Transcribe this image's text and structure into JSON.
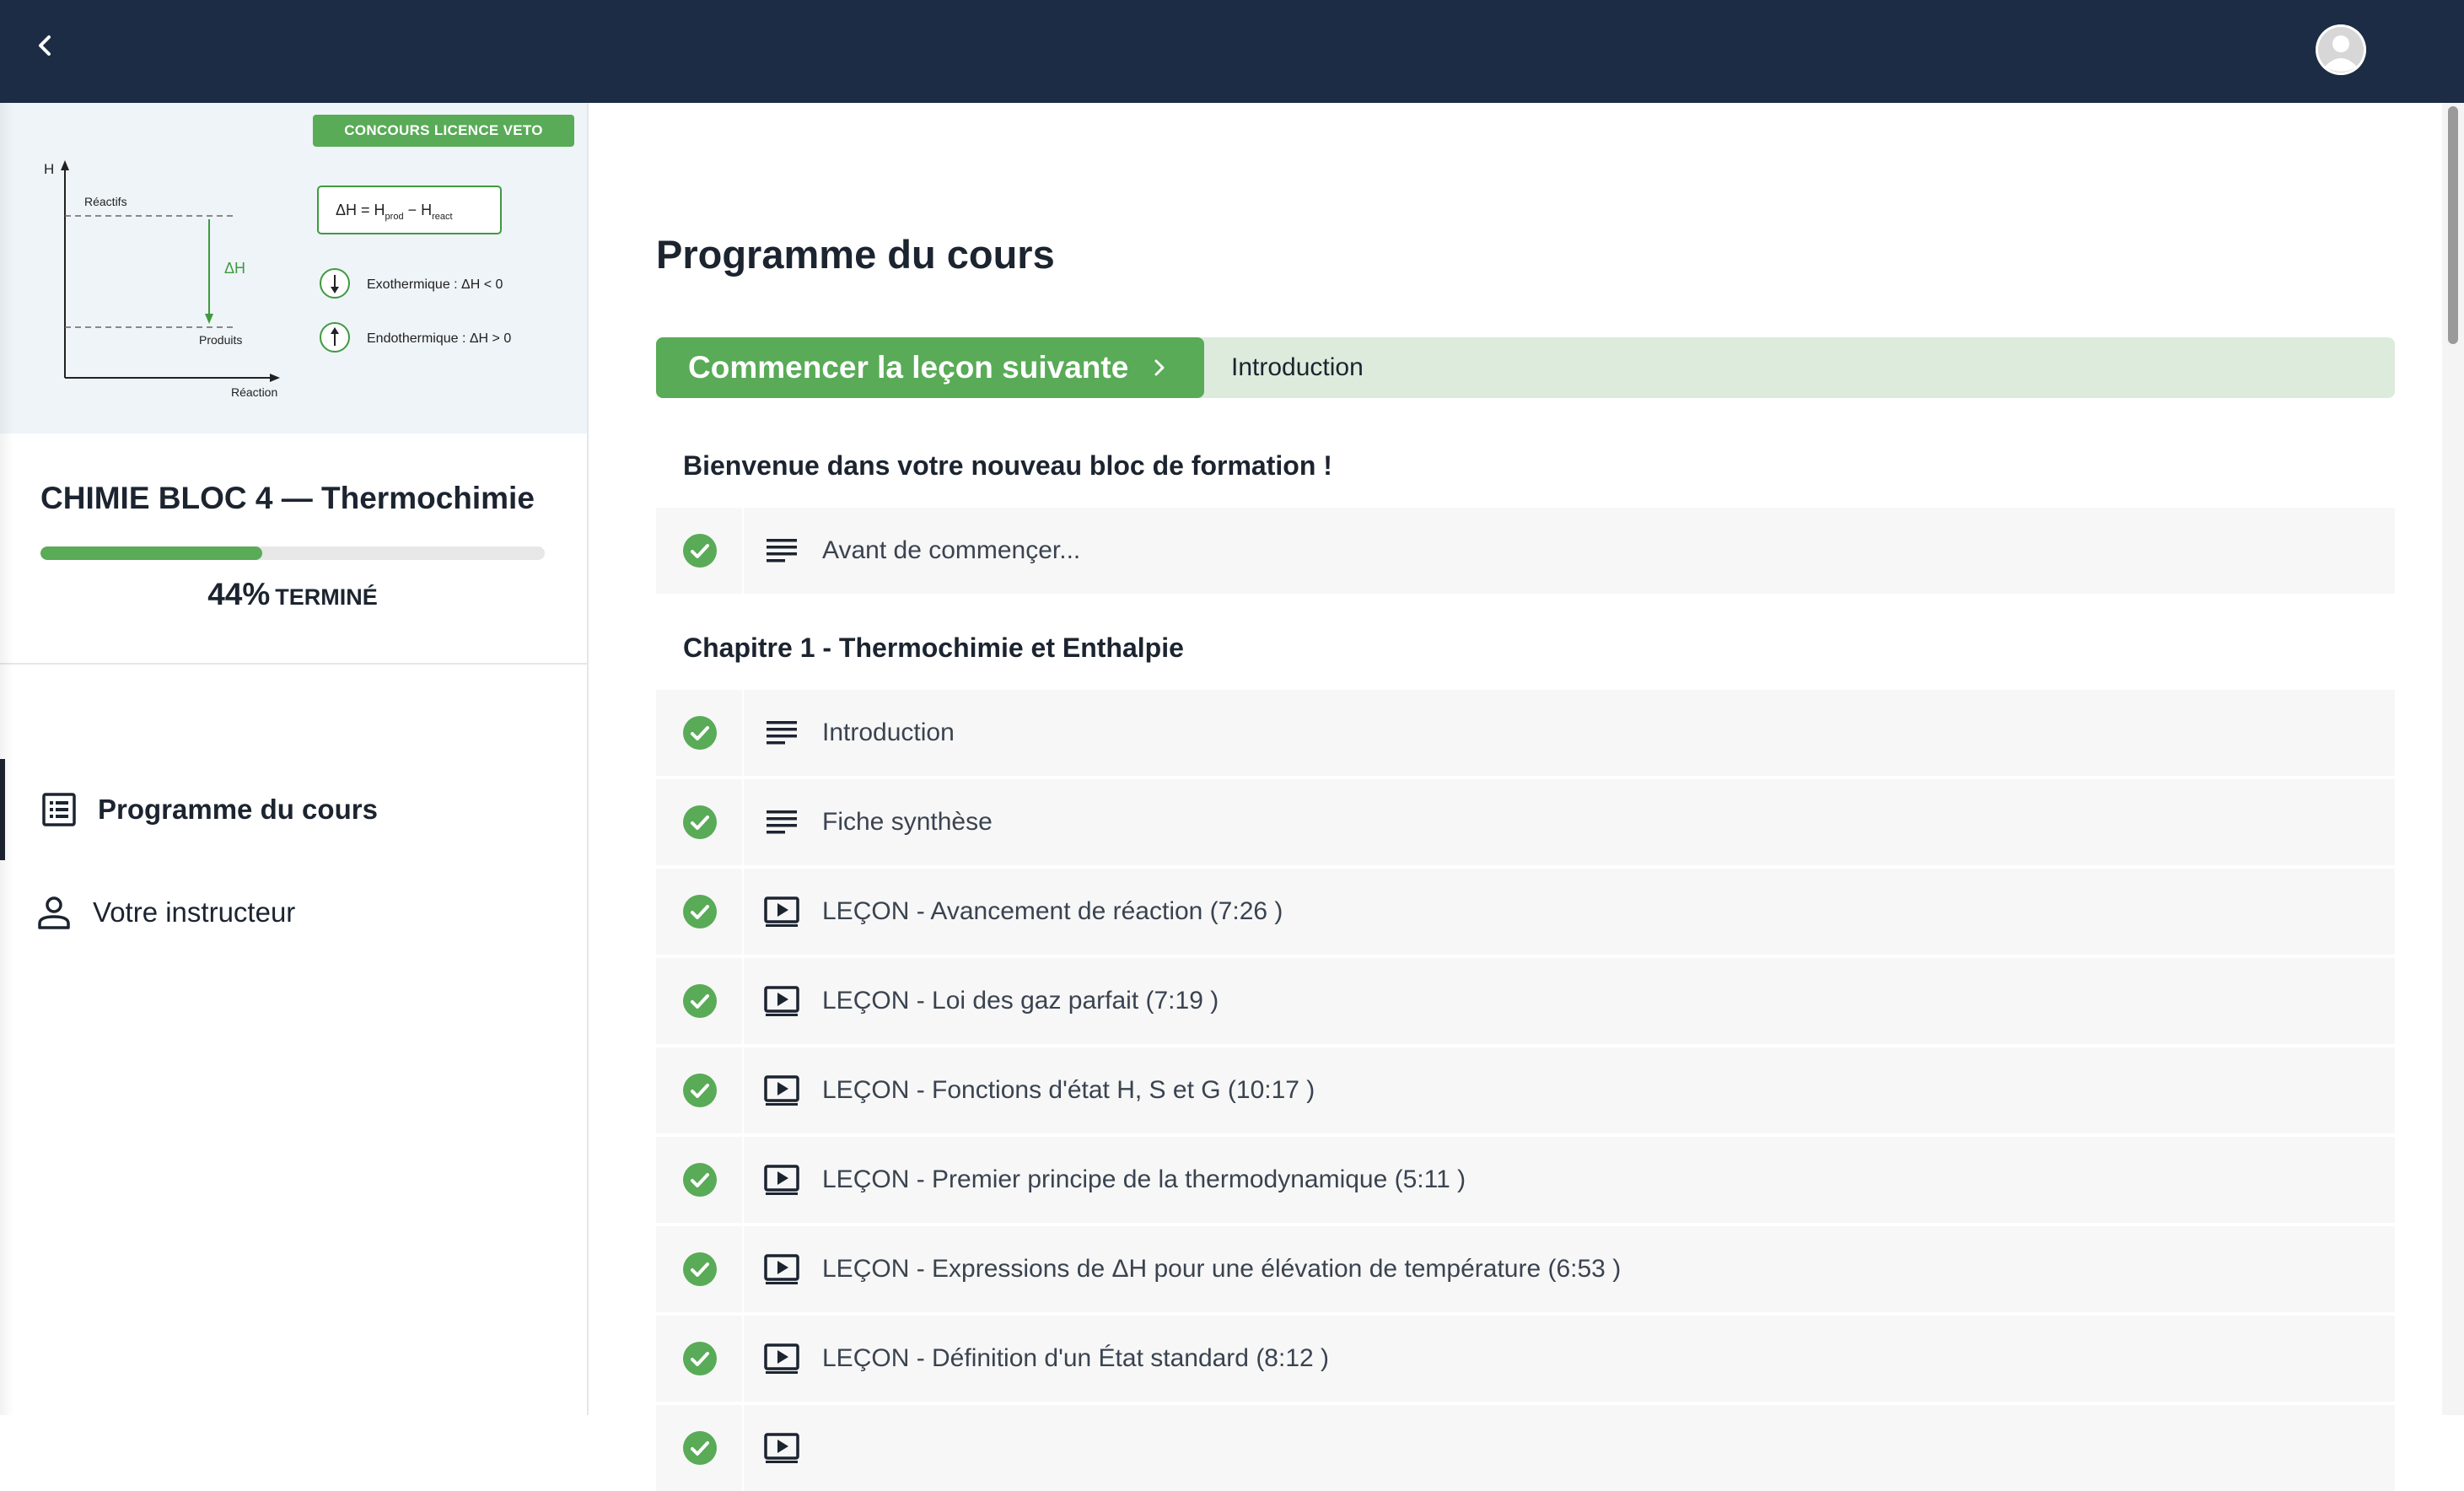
{
  "topbar": {
    "back_icon": "chevron-left-icon",
    "avatar_icon": "user-avatar"
  },
  "sidebar": {
    "thumbnail": {
      "badge": "CONCOURS LICENCE VETO",
      "axis_y": "H",
      "axis_x": "Réaction",
      "reactifs": "Réactifs",
      "produits": "Produits",
      "delta_h": "ΔH",
      "formula_lhs": "ΔH = H",
      "formula_prod_sub": "prod",
      "formula_minus": " − H",
      "formula_react_sub": "react",
      "exo": "Exothermique : ΔH < 0",
      "endo": "Endothermique : ΔH > 0"
    },
    "course_title": "CHIMIE BLOC 4 — Thermochimie",
    "progress": {
      "value": 44,
      "percent_label": "44%",
      "status_label": "TERMINÉ"
    },
    "nav": [
      {
        "label": "Programme du cours",
        "icon": "list-icon",
        "active": true
      },
      {
        "label": "Votre instructeur",
        "icon": "person-icon",
        "active": false
      }
    ]
  },
  "main": {
    "title": "Programme du cours",
    "next": {
      "button_label": "Commencer la leçon suivante",
      "lesson": "Introduction"
    },
    "sections": [
      {
        "title": "Bienvenue dans votre nouveau bloc de formation !",
        "lessons": [
          {
            "label": "Avant de commençer...",
            "type": "text",
            "completed": true
          }
        ]
      },
      {
        "title": "Chapitre 1 - Thermochimie et Enthalpie",
        "lessons": [
          {
            "label": "Introduction",
            "type": "text",
            "completed": true
          },
          {
            "label": "Fiche synthèse",
            "type": "text",
            "completed": true
          },
          {
            "label": "LEÇON - Avancement de réaction (7:26 )",
            "type": "video",
            "completed": true
          },
          {
            "label": "LEÇON - Loi des gaz parfait (7:19 )",
            "type": "video",
            "completed": true
          },
          {
            "label": "LEÇON - Fonctions d'état H, S et G (10:17 )",
            "type": "video",
            "completed": true
          },
          {
            "label": "LEÇON - Premier principe de la thermodynamique (5:11 )",
            "type": "video",
            "completed": true
          },
          {
            "label": "LEÇON - Expressions de ΔH pour une élévation de température (6:53 )",
            "type": "video",
            "completed": true
          },
          {
            "label": "LEÇON - Définition d'un État standard (8:12 )",
            "type": "video",
            "completed": true
          }
        ]
      }
    ]
  },
  "colors": {
    "topbar": "#1d2c45",
    "accent": "#59ab57",
    "accent_light": "#dcebdc",
    "text": "#1c2430"
  }
}
